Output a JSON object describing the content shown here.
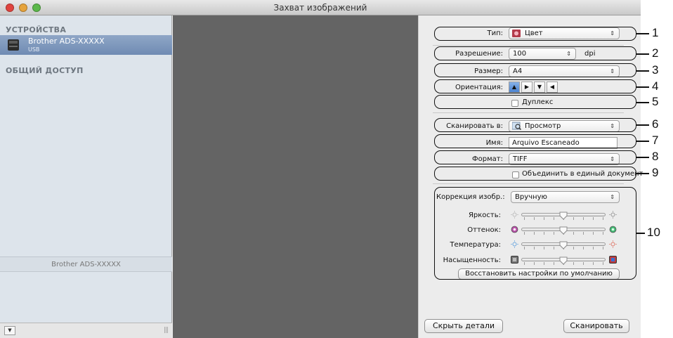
{
  "window": {
    "title": "Захват изображений"
  },
  "sidebar": {
    "devices_header": "УСТРОЙСТВА",
    "device": {
      "name": "Brother ADS-XXXXX",
      "connection": "USB"
    },
    "shared_header": "ОБЩИЙ ДОСТУП",
    "footer_label": "Brother ADS-XXXXX"
  },
  "settings": {
    "type": {
      "label": "Тип:",
      "value": "Цвет"
    },
    "resolution": {
      "label": "Разрешение:",
      "value": "100",
      "unit": "dpi"
    },
    "size": {
      "label": "Размер:",
      "value": "A4"
    },
    "orientation": {
      "label": "Ориентация:",
      "options": [
        "portrait",
        "landscape-left",
        "portrait-flipped",
        "landscape-right"
      ],
      "selected_index": 0
    },
    "duplex": {
      "label": "Дуплекс",
      "checked": false
    },
    "scan_to": {
      "label": "Сканировать в:",
      "value": "Просмотр"
    },
    "name": {
      "label": "Имя:",
      "value": "Arquivo Escaneado"
    },
    "format": {
      "label": "Формат:",
      "value": "TIFF"
    },
    "combine": {
      "label": "Объединить в единый документ",
      "checked": false
    },
    "correction": {
      "label": "Коррекция изобр.:",
      "value": "Вручную"
    },
    "sliders": [
      {
        "label": "Яркость:",
        "value": 0.5,
        "icon": "sun-icon"
      },
      {
        "label": "Оттенок:",
        "value": 0.5,
        "icon": "tint-icon"
      },
      {
        "label": "Температура:",
        "value": 0.5,
        "icon": "temperature-icon"
      },
      {
        "label": "Насыщенность:",
        "value": 0.5,
        "icon": "saturation-icon"
      }
    ],
    "restore_defaults": "Восстановить настройки по умолчанию"
  },
  "buttons": {
    "hide_details": "Скрыть детали",
    "scan": "Сканировать"
  },
  "callouts": [
    "1",
    "2",
    "3",
    "4",
    "5",
    "6",
    "7",
    "8",
    "9",
    "10"
  ],
  "colors": {
    "sidebar_bg": "#dde4eb",
    "selected_device": "#7b95bb",
    "preview_bg": "#646464",
    "panel_bg": "#ececec"
  }
}
